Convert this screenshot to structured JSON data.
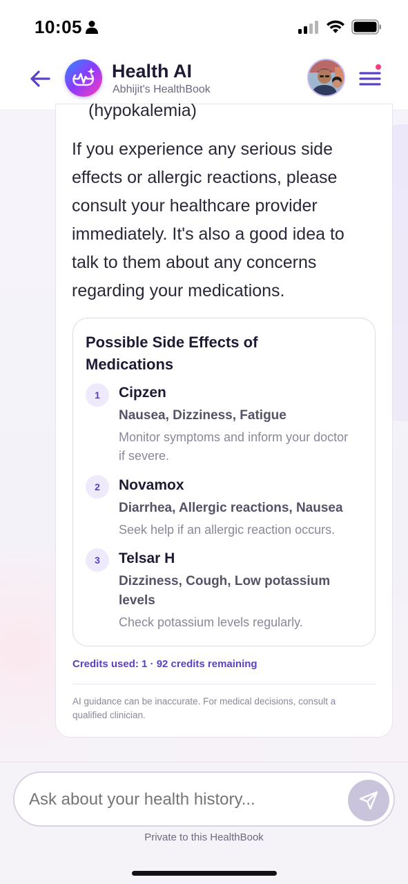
{
  "status_bar": {
    "time": "10:05"
  },
  "header": {
    "title": "Health AI",
    "subtitle": "Abhijit's HealthBook"
  },
  "message": {
    "cut_off_text": "(hypokalemia)",
    "body": "If you experience any serious side effects or allergic reactions, please consult your healthcare provider immediately. It's also a good idea to talk to them about any concerns regarding your medications."
  },
  "side_effects": {
    "title": "Possible Side Effects of Medications",
    "items": [
      {
        "number": "1",
        "name": "Cipzen",
        "effects": "Nausea, Dizziness, Fatigue",
        "advice": "Monitor symptoms and inform your doctor if severe."
      },
      {
        "number": "2",
        "name": "Novamox",
        "effects": "Diarrhea, Allergic reactions, Nausea",
        "advice": "Seek help if an allergic reaction occurs."
      },
      {
        "number": "3",
        "name": "Telsar H",
        "effects": "Dizziness, Cough, Low potassium levels",
        "advice": "Check potassium levels regularly."
      }
    ]
  },
  "credits": "Credits used: 1 · 92 credits remaining",
  "disclaimer": "AI guidance can be inaccurate. For medical decisions, consult a qualified clinician.",
  "composer": {
    "placeholder": "Ask about your health history..."
  },
  "private_note": "Private to this HealthBook",
  "colors": {
    "accent": "#5b3fc4",
    "notification_dot": "#ff3b7b",
    "send_disabled": "#c9c4dc"
  }
}
